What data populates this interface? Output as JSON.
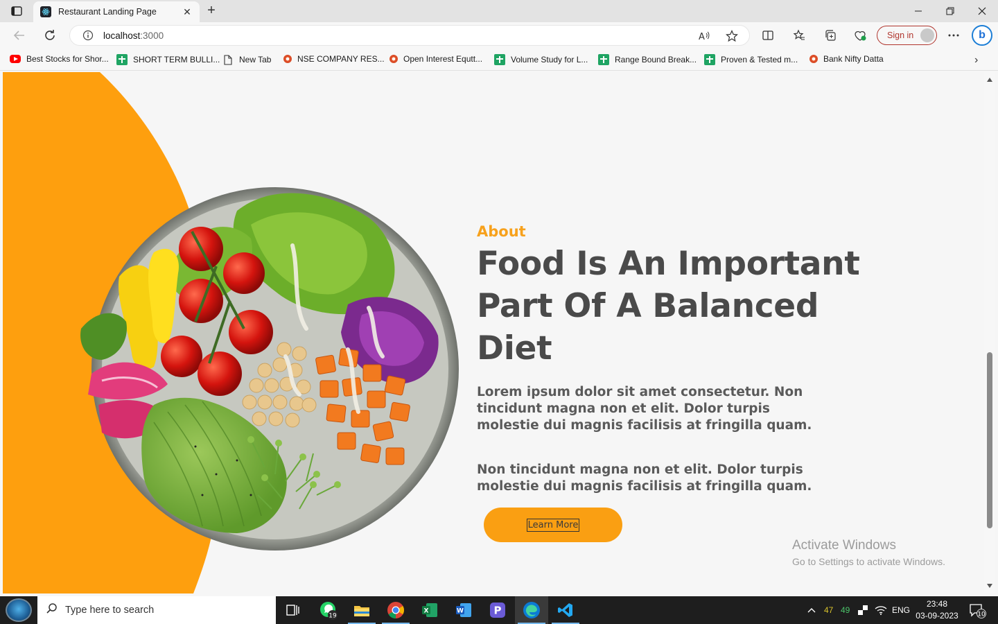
{
  "browser": {
    "tab_title": "Restaurant Landing Page",
    "url_host": "localhost",
    "url_port": ":3000",
    "sign_in": "Sign in"
  },
  "bookmarks": [
    {
      "label": "Best Stocks for Shor...",
      "icon": "youtube-icon"
    },
    {
      "label": "SHORT TERM BULLI...",
      "icon": "sheets-icon"
    },
    {
      "label": "New Tab",
      "icon": "page-icon"
    },
    {
      "label": "NSE COMPANY RES...",
      "icon": "nse-icon"
    },
    {
      "label": "Open Interest Equtt...",
      "icon": "nse-icon"
    },
    {
      "label": "Volume Study for L...",
      "icon": "sheets-icon"
    },
    {
      "label": "Range Bound Break...",
      "icon": "sheets-icon"
    },
    {
      "label": "Proven & Tested m...",
      "icon": "sheets-icon"
    },
    {
      "label": "Bank Nifty Datta",
      "icon": "nse-icon"
    }
  ],
  "page": {
    "about": "About",
    "headline_line1": "Food Is An Important",
    "headline_line2": "Part Of A Balanced",
    "headline_line3": "Diet",
    "paragraph1": "Lorem ipsum dolor sit amet consectetur. Non tincidunt magna non et elit. Dolor turpis molestie dui magnis facilisis at fringilla quam.",
    "paragraph2": "Non tincidunt magna non et elit. Dolor turpis molestie dui magnis facilisis at fringilla quam.",
    "button": "Learn More",
    "accent_color": "#fa9f12",
    "heading_color": "#4a4a4a"
  },
  "watermark": {
    "line1": "Activate Windows",
    "line2": "Go to Settings to activate Windows."
  },
  "taskbar": {
    "search_placeholder": "Type here to search",
    "whatsapp_badge": "19",
    "temp1": "47",
    "temp2": "49",
    "lang": "ENG",
    "time": "23:48",
    "date": "03-09-2023",
    "notifications": "10"
  }
}
